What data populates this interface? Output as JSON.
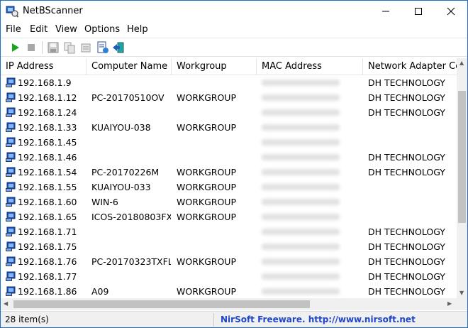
{
  "window": {
    "title": "NetBScanner"
  },
  "menu": [
    "File",
    "Edit",
    "View",
    "Options",
    "Help"
  ],
  "columns": [
    "IP Address",
    "Computer Name",
    "Workgroup",
    "MAC Address",
    "Network Adapter Co"
  ],
  "rows": [
    {
      "ip": "192.168.1.9",
      "computer": "",
      "workgroup": "",
      "vendor": "DH TECHNOLOGY"
    },
    {
      "ip": "192.168.1.12",
      "computer": "PC-20170510OV",
      "workgroup": "WORKGROUP",
      "vendor": "DH TECHNOLOGY"
    },
    {
      "ip": "192.168.1.24",
      "computer": "",
      "workgroup": "",
      "vendor": "DH TECHNOLOGY"
    },
    {
      "ip": "192.168.1.33",
      "computer": "KUAIYOU-038",
      "workgroup": "WORKGROUP",
      "vendor": ""
    },
    {
      "ip": "192.168.1.45",
      "computer": "",
      "workgroup": "",
      "vendor": ""
    },
    {
      "ip": "192.168.1.46",
      "computer": "",
      "workgroup": "",
      "vendor": "DH TECHNOLOGY"
    },
    {
      "ip": "192.168.1.54",
      "computer": "PC-20170226M",
      "workgroup": "WORKGROUP",
      "vendor": "DH TECHNOLOGY"
    },
    {
      "ip": "192.168.1.55",
      "computer": "KUAIYOU-033",
      "workgroup": "WORKGROUP",
      "vendor": ""
    },
    {
      "ip": "192.168.1.60",
      "computer": "WIN-6",
      "workgroup": "WORKGROUP",
      "vendor": ""
    },
    {
      "ip": "192.168.1.65",
      "computer": "ICOS-20180803FX",
      "workgroup": "WORKGROUP",
      "vendor": ""
    },
    {
      "ip": "192.168.1.71",
      "computer": "",
      "workgroup": "",
      "vendor": "DH TECHNOLOGY"
    },
    {
      "ip": "192.168.1.75",
      "computer": "",
      "workgroup": "",
      "vendor": "DH TECHNOLOGY"
    },
    {
      "ip": "192.168.1.76",
      "computer": "PC-20170323TXFL",
      "workgroup": "WORKGROUP",
      "vendor": "DH TECHNOLOGY"
    },
    {
      "ip": "192.168.1.77",
      "computer": "",
      "workgroup": "",
      "vendor": "DH TECHNOLOGY"
    },
    {
      "ip": "192.168.1.86",
      "computer": "A09",
      "workgroup": "WORKGROUP",
      "vendor": "DH TECHNOLOGY"
    }
  ],
  "status": {
    "items": "28 item(s)",
    "credit": "NirSoft Freeware.  http://www.nirsoft.net"
  },
  "colors": {
    "accent": "#1f6fc5",
    "link": "#1e46c8",
    "play": "#1aa51a"
  },
  "icons": [
    "app-icon",
    "play-icon",
    "stop-icon",
    "save-icon",
    "copy-icon",
    "properties-icon",
    "html-report-icon",
    "exit-icon",
    "computer-icon"
  ]
}
